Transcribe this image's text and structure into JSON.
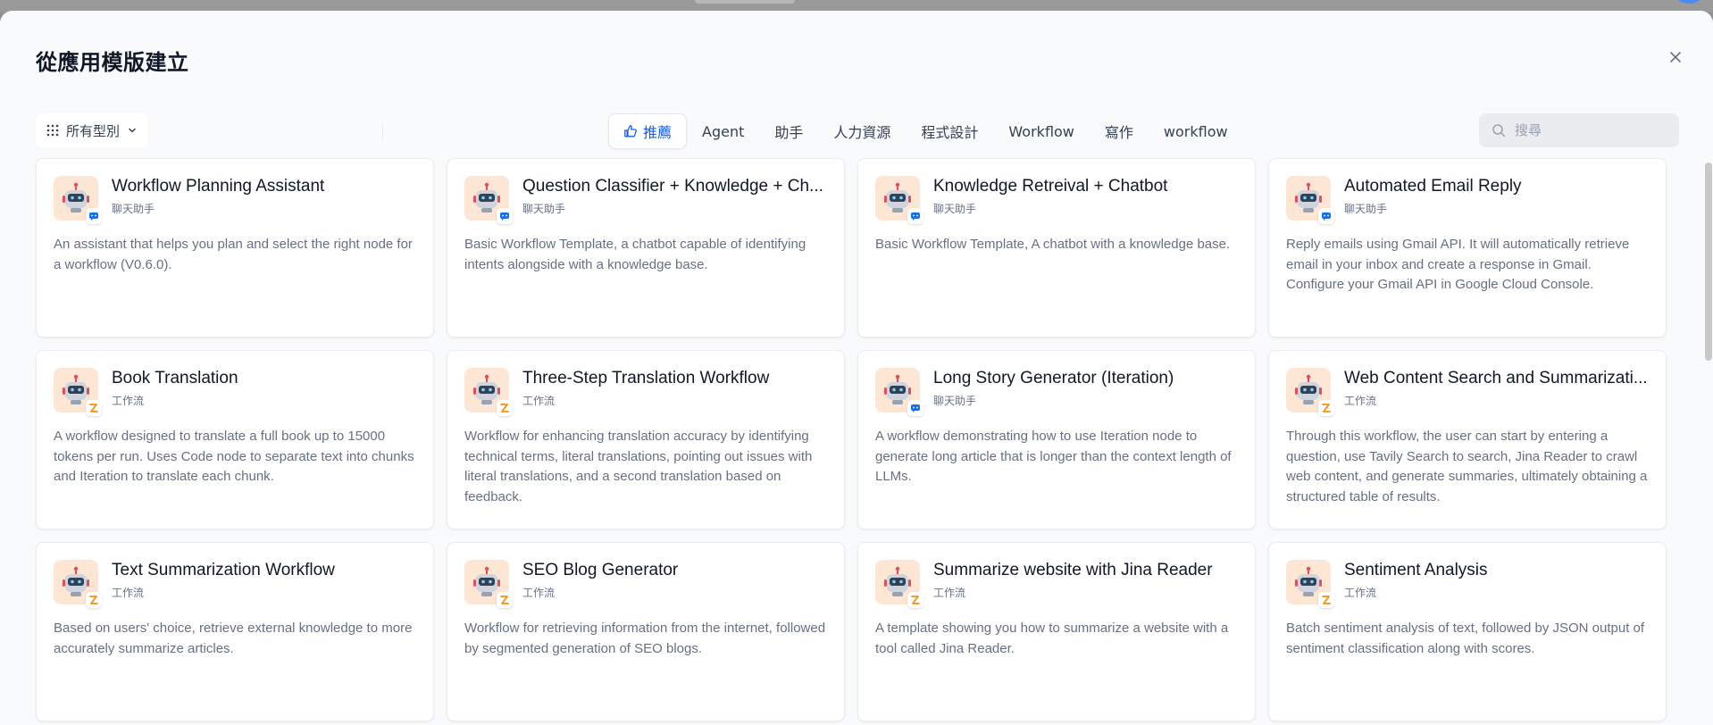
{
  "modal": {
    "title": "從應用模版建立"
  },
  "toolbar": {
    "type_filter_label": "所有型別",
    "tabs": [
      {
        "label": "推薦",
        "active": true,
        "icon": "thumbs-up-icon"
      },
      {
        "label": "Agent",
        "active": false
      },
      {
        "label": "助手",
        "active": false
      },
      {
        "label": "人力資源",
        "active": false
      },
      {
        "label": "程式設計",
        "active": false
      },
      {
        "label": "Workflow",
        "active": false
      },
      {
        "label": "寫作",
        "active": false
      },
      {
        "label": "workflow",
        "active": false
      }
    ],
    "search_placeholder": "搜尋"
  },
  "colors": {
    "accent": "#155eef",
    "icon_bg": "#fde6d4",
    "chat_badge": "#1570ef",
    "workflow_badge": "#f79009"
  },
  "cards": [
    {
      "title": "Workflow Planning Assistant",
      "type": "聊天助手",
      "badge": "chat-bubble-icon",
      "desc": "An assistant that helps you plan and select the right node for a workflow (V0.6.0)."
    },
    {
      "title": "Question Classifier + Knowledge + Ch...",
      "type": "聊天助手",
      "badge": "chat-bubble-icon",
      "desc": "Basic Workflow Template, a chatbot capable of identifying intents alongside with a knowledge base."
    },
    {
      "title": "Knowledge Retreival + Chatbot",
      "type": "聊天助手",
      "badge": "chat-bubble-icon",
      "desc": "Basic Workflow Template, A chatbot with a knowledge base."
    },
    {
      "title": "Automated Email Reply",
      "type": "聊天助手",
      "badge": "chat-bubble-icon",
      "desc": "Reply emails using Gmail API. It will automatically retrieve email in your inbox and create a response in Gmail. Configure your Gmail API in Google Cloud Console."
    },
    {
      "title": "Book Translation",
      "type": "工作流",
      "badge": "workflow-icon",
      "desc": "A workflow designed to translate a full book up to 15000 tokens per run. Uses Code node to separate text into chunks and Iteration to translate each chunk."
    },
    {
      "title": "Three-Step Translation Workflow",
      "type": "工作流",
      "badge": "workflow-icon",
      "desc": "Workflow for enhancing translation accuracy by identifying technical terms, literal translations, pointing out issues with literal translations, and a second translation based on feedback."
    },
    {
      "title": "Long Story Generator (Iteration)",
      "type": "聊天助手",
      "badge": "chat-bubble-icon",
      "desc": "A workflow demonstrating how to use Iteration node to generate long article that is longer than the context length of LLMs."
    },
    {
      "title": "Web Content Search and Summarizati...",
      "type": "工作流",
      "badge": "workflow-icon",
      "desc": "Through this workflow, the user can start by entering a question, use Tavily Search to search, Jina Reader to crawl web content, and generate summaries, ultimately obtaining a structured table of results."
    },
    {
      "title": "Text Summarization Workflow",
      "type": "工作流",
      "badge": "workflow-icon",
      "desc": "Based on users' choice, retrieve external knowledge to more accurately summarize articles."
    },
    {
      "title": "SEO Blog Generator",
      "type": "工作流",
      "badge": "workflow-icon",
      "desc": "Workflow for retrieving information from the internet, followed by segmented generation of SEO blogs."
    },
    {
      "title": "Summarize website with Jina Reader",
      "type": "工作流",
      "badge": "workflow-icon",
      "desc": "A template showing you how to summarize a website with a tool called Jina Reader."
    },
    {
      "title": "Sentiment Analysis",
      "type": "工作流",
      "badge": "workflow-icon",
      "desc": "Batch sentiment analysis of text, followed by JSON output of sentiment classification along with scores."
    }
  ]
}
